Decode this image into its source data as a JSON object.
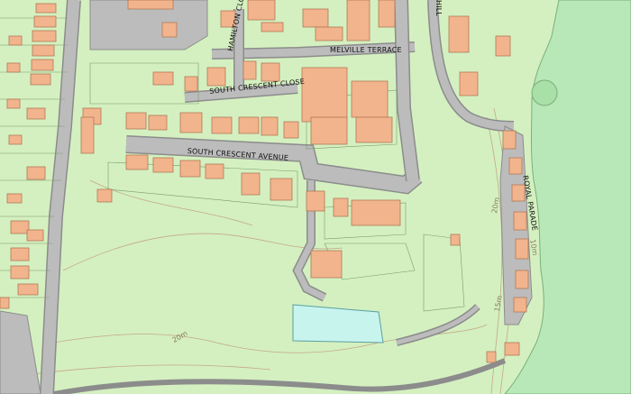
{
  "map": {
    "street_labels": {
      "melville_terrace": "MELVILLE TERRACE",
      "south_crescent_close": "SOUTH CRESCENT CLOSE",
      "hamilton_close": "HAMILTON CLOSE",
      "south_crescent_avenue": "SOUTH CRESCENT AVENUE",
      "royal_parade": "ROYAL PARADE",
      "hill": "HILL"
    },
    "contour_labels": {
      "c20_east": "20m",
      "c15_east": "15m",
      "c10_east": "10m",
      "c20_south": "20m"
    },
    "colors": {
      "open_land": "#d4f0c0",
      "sea_margin": "#b8e8b8",
      "building": "#f2b48c",
      "building_outline": "#b07a58",
      "road": "#bcbcbc",
      "road_casing": "#8c8c8c",
      "water": "#c8f4ee",
      "contour": "#c4a888",
      "boundary": "#7a9a6a"
    }
  }
}
